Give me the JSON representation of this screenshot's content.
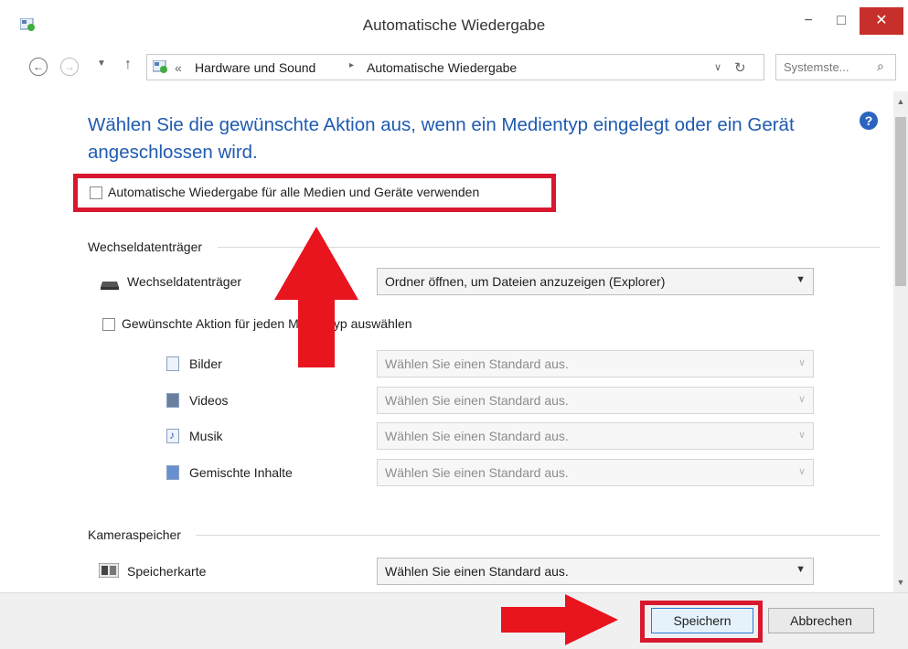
{
  "window": {
    "title": "Automatische Wiedergabe",
    "controls": {
      "minimize": "−",
      "maximize": "□",
      "close": "✕"
    }
  },
  "address_bar": {
    "crumbs": [
      "«",
      "Hardware und Sound",
      "▸",
      "Automatische Wiedergabe"
    ],
    "search_placeholder": "Systemste..."
  },
  "content": {
    "heading": "Wählen Sie die gewünschte Aktion aus, wenn ein Medientyp eingelegt oder ein Gerät angeschlossen wird.",
    "help_glyph": "?",
    "autoplay_checkbox_label": "Automatische Wiedergabe für alle Medien und Geräte verwenden",
    "removable_group": "Wechseldatenträger",
    "removable_item_label": "Wechseldatenträger",
    "removable_select_value": "Ordner öffnen, um Dateien anzuzeigen (Explorer)",
    "per_media_checkbox_label": "Gewünschte Aktion für jeden Medientyp auswählen",
    "media_types": [
      {
        "label": "Bilder",
        "value": "Wählen Sie einen Standard aus."
      },
      {
        "label": "Videos",
        "value": "Wählen Sie einen Standard aus."
      },
      {
        "label": "Musik",
        "value": "Wählen Sie einen Standard aus."
      },
      {
        "label": "Gemischte Inhalte",
        "value": "Wählen Sie einen Standard aus."
      }
    ],
    "camera_group": "Kameraspeicher",
    "memory_card_label": "Speicherkarte",
    "memory_card_value": "Wählen Sie einen Standard aus."
  },
  "footer": {
    "save_label": "Speichern",
    "cancel_label": "Abbrechen"
  },
  "colors": {
    "annotation_red": "#d8182e",
    "heading_blue": "#1f5bb0",
    "close_red": "#c7302a"
  }
}
